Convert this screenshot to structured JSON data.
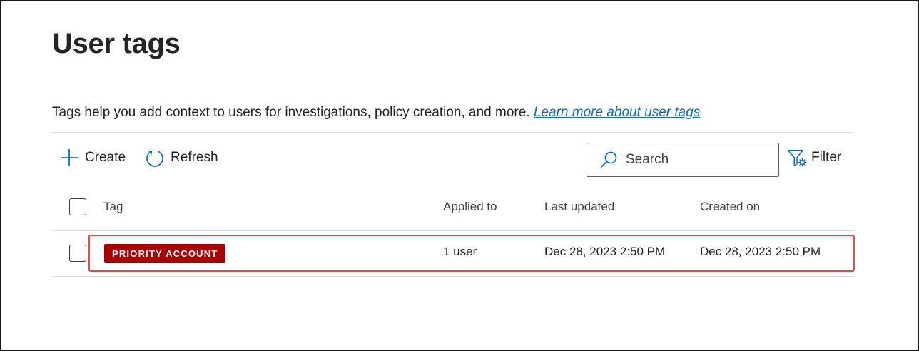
{
  "page": {
    "title": "User tags",
    "description": "Tags help you add context to users for investigations, policy creation, and more.",
    "learn_more_link": "Learn more about user tags"
  },
  "toolbar": {
    "create_label": "Create",
    "refresh_label": "Refresh",
    "search_placeholder": "Search",
    "filter_label": "Filter"
  },
  "table": {
    "columns": [
      "Tag",
      "Applied to",
      "Last updated",
      "Created on"
    ],
    "rows": [
      {
        "tag": "PRIORITY ACCOUNT",
        "applied_to": "1 user",
        "last_updated": "Dec 28, 2023 2:50 PM",
        "created_on": "Dec 28, 2023 2:50 PM"
      }
    ]
  },
  "colors": {
    "accent": "#0f6cbd",
    "tag_badge": "#a80000",
    "highlight": "#e8474f"
  }
}
